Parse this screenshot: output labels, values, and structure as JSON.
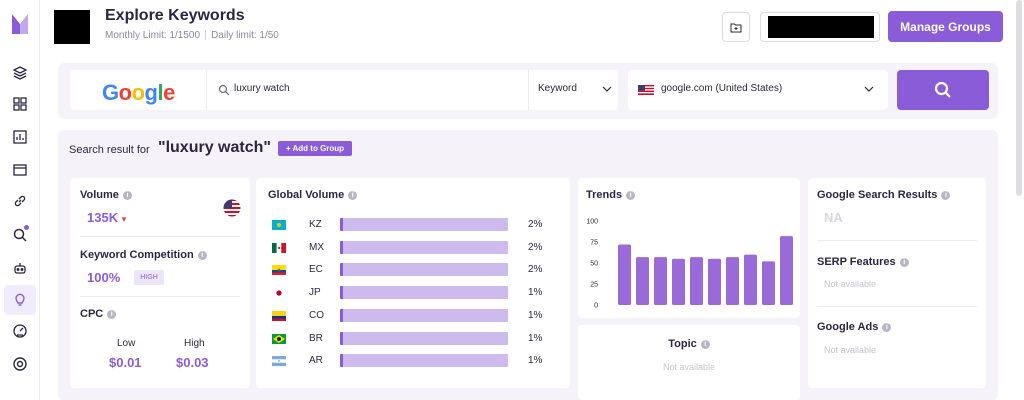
{
  "colors": {
    "accent": "#8a5cd8",
    "bar_light": "#cdbbee",
    "trend_bar": "#9a6ad8"
  },
  "sidebar": {
    "items": [
      {
        "icon": "layers-icon"
      },
      {
        "icon": "grid-icon"
      },
      {
        "icon": "bar-chart-icon"
      },
      {
        "icon": "browser-icon"
      },
      {
        "icon": "link-icon"
      },
      {
        "icon": "search-icon"
      },
      {
        "icon": "robot-icon"
      },
      {
        "icon": "bulb-icon"
      },
      {
        "icon": "gauge-icon"
      },
      {
        "icon": "settings-icon"
      }
    ]
  },
  "header": {
    "title": "Explore Keywords",
    "monthly_limit": "Monthly Limit: 1/1500",
    "daily_limit": "Daily limit: 1/50",
    "manage_label": "Manage Groups"
  },
  "search": {
    "engine_logo": "Google",
    "query": "luxury watch",
    "type": "Keyword",
    "country": "google.com (United States)"
  },
  "result": {
    "label": "Search result for",
    "query": "\"luxury watch\"",
    "add_label": "+ Add to Group"
  },
  "volume": {
    "label": "Volume",
    "value": "135K",
    "trend_arrow": "▾"
  },
  "competition": {
    "label": "Keyword Competition",
    "value": "100%",
    "badge": "HIGH"
  },
  "cpc": {
    "label": "CPC",
    "low_label": "Low",
    "high_label": "High",
    "low_value": "$0.01",
    "high_value": "$0.03"
  },
  "global_volume": {
    "label": "Global Volume",
    "rows": [
      {
        "code": "KZ",
        "pct": "2%",
        "fraction": 0.02
      },
      {
        "code": "MX",
        "pct": "2%",
        "fraction": 0.02
      },
      {
        "code": "EC",
        "pct": "2%",
        "fraction": 0.02
      },
      {
        "code": "JP",
        "pct": "1%",
        "fraction": 0.01
      },
      {
        "code": "CO",
        "pct": "1%",
        "fraction": 0.01
      },
      {
        "code": "BR",
        "pct": "1%",
        "fraction": 0.01
      },
      {
        "code": "AR",
        "pct": "1%",
        "fraction": 0.01
      }
    ]
  },
  "trends": {
    "label": "Trends"
  },
  "chart_data": {
    "type": "bar",
    "ylim": [
      0,
      100
    ],
    "yticks": [
      "100",
      "75",
      "50",
      "25",
      "0"
    ],
    "values": [
      72,
      57,
      57,
      55,
      57,
      55,
      57,
      60,
      52,
      82
    ]
  },
  "topic": {
    "label": "Topic",
    "value": "Not available"
  },
  "google_results": {
    "label": "Google Search Results",
    "value": "NA"
  },
  "serp": {
    "label": "SERP Features",
    "value": "Not available"
  },
  "ads": {
    "label": "Google Ads",
    "value": "Not available"
  }
}
